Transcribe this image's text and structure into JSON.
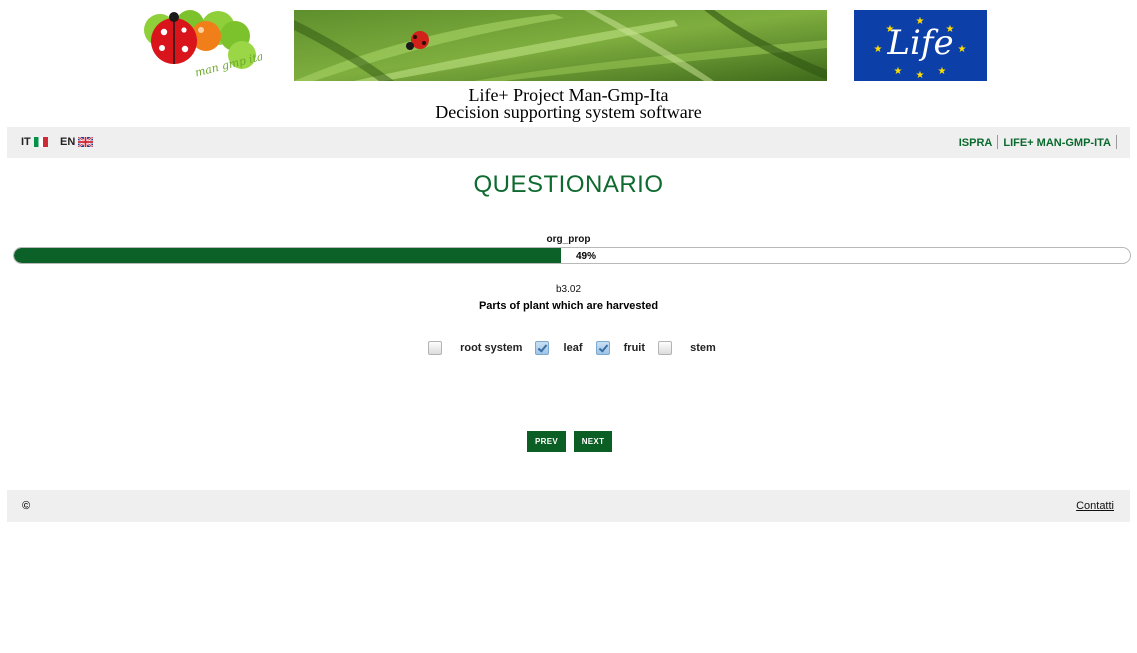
{
  "header": {
    "logo_text": "man gmp ita",
    "eu_logo_text": "Life",
    "title_line1": "Life+ Project Man-Gmp-Ita",
    "title_line2": "Decision supporting system software"
  },
  "nav": {
    "lang_it": "IT",
    "lang_en": "EN",
    "links": [
      "ISPRA",
      "LIFE+ MAN-GMP-ITA"
    ]
  },
  "questionnaire": {
    "title": "QUESTIONARIO",
    "section": "org_prop",
    "progress_percent": 49,
    "progress_label": "49%",
    "question_code": "b3.02",
    "question_text": "Parts of plant which are harvested",
    "options": [
      {
        "label": "root system",
        "checked": false
      },
      {
        "label": "leaf",
        "checked": true
      },
      {
        "label": "fruit",
        "checked": true
      },
      {
        "label": "stem",
        "checked": false
      }
    ],
    "prev_label": "PREV",
    "next_label": "NEXT"
  },
  "footer": {
    "copyright": "©",
    "contact_link": "Contatti"
  },
  "colors": {
    "brand_green": "#0f6a2f",
    "progress_green": "#0b6127",
    "button_green": "#0b5e24",
    "eu_blue": "#0c3fa8",
    "bar_gray": "#efefef"
  },
  "icons": [
    "ladybug-logo-icon",
    "italy-flag-icon",
    "uk-flag-icon",
    "eu-life-logo-icon",
    "checkbox-icon"
  ]
}
